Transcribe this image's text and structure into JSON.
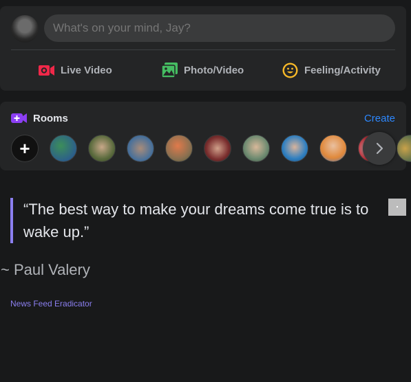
{
  "composer": {
    "placeholder": "What's on your mind, Jay?",
    "actions": [
      {
        "label": "Live Video",
        "icon": "live-video-icon",
        "color": "#f02849"
      },
      {
        "label": "Photo/Video",
        "icon": "photo-icon",
        "color": "#45bd62"
      },
      {
        "label": "Feeling/Activity",
        "icon": "smiley-icon",
        "color": "#f7b928"
      }
    ]
  },
  "rooms": {
    "title": "Rooms",
    "create_label": "Create",
    "create_room_symbol": "+",
    "accent": "#8c3ff4",
    "room_avatar_count": 10
  },
  "quote": {
    "text": "“The best way to make your dreams come true is to wake up.”",
    "author": "~ Paul Valery"
  },
  "extension": {
    "link_label": "News Feed Eradicator",
    "accent": "#8b7ff0"
  }
}
